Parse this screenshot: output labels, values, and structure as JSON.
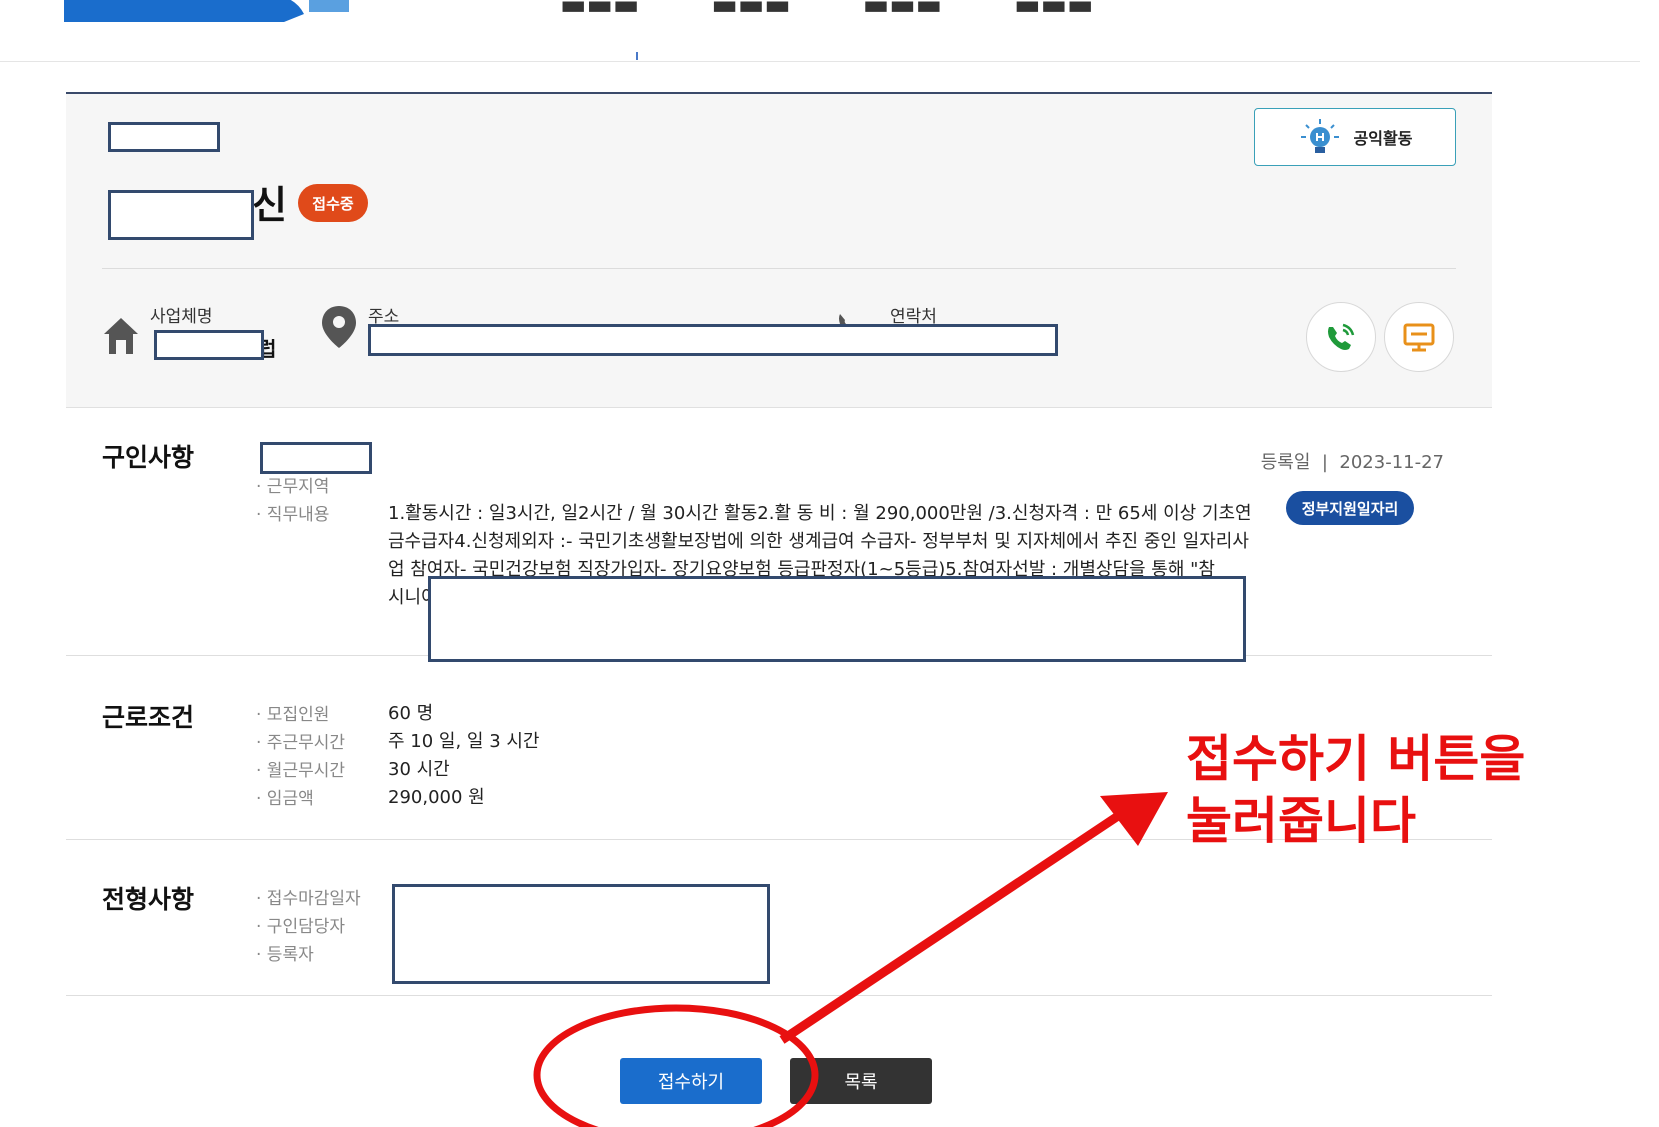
{
  "nav": {
    "menu": [
      "",
      "",
      "",
      ""
    ]
  },
  "summary": {
    "category_label": "공익활동",
    "title_suffix": "신",
    "status": "접수중",
    "company_label": "사업체명",
    "company_value_suffix": "럽",
    "address_label": "주소",
    "contact_label": "연락처"
  },
  "recruit": {
    "section_title": "구인사항",
    "rows": [
      "· 근무지역",
      "· 직무내용"
    ],
    "description": "1.활동시간 : 일3시간, 일2시간  / 월 30시간 활동2.활 동 비 : 월 290,000만원 /3.신청자격 : 만 65세 이상 기초연금수급자4.신청제외자 :- 국민기초생활보장법에 의한 생계급여 수급자- 정부부처 및 지자체에서 추진 중인 일자리사업 참여자- 국민건강보험 직장가입자- 장기요양보험 등급판정자(1~5등급)5.참여자선발 : 개별상담을 통해 \"참",
    "description_tail": "시니어",
    "reg_label": "등록일",
    "reg_sep": "|",
    "reg_date": "2023-11-27",
    "badge": "정부지원일자리"
  },
  "conditions": {
    "section_title": "근로조건",
    "rows": [
      {
        "label": "· 모집인원",
        "value": "60 명"
      },
      {
        "label": "· 주근무시간",
        "value": "주 10 일, 일 3 시간"
      },
      {
        "label": "· 월근무시간",
        "value": "30 시간"
      },
      {
        "label": "· 임금액",
        "value": "290,000 원"
      }
    ]
  },
  "screening": {
    "section_title": "전형사항",
    "rows": [
      "· 접수마감일자",
      "· 구인담당자",
      "· 등록자"
    ]
  },
  "actions": {
    "apply": "접수하기",
    "list": "목록"
  },
  "annotation": {
    "line1": "접수하기 버튼을",
    "line2": "눌러줍니다",
    "color": "#e81010"
  },
  "colors": {
    "primary": "#1a6dcc",
    "status": "#e04a1a",
    "badge": "#1a4fa0"
  }
}
